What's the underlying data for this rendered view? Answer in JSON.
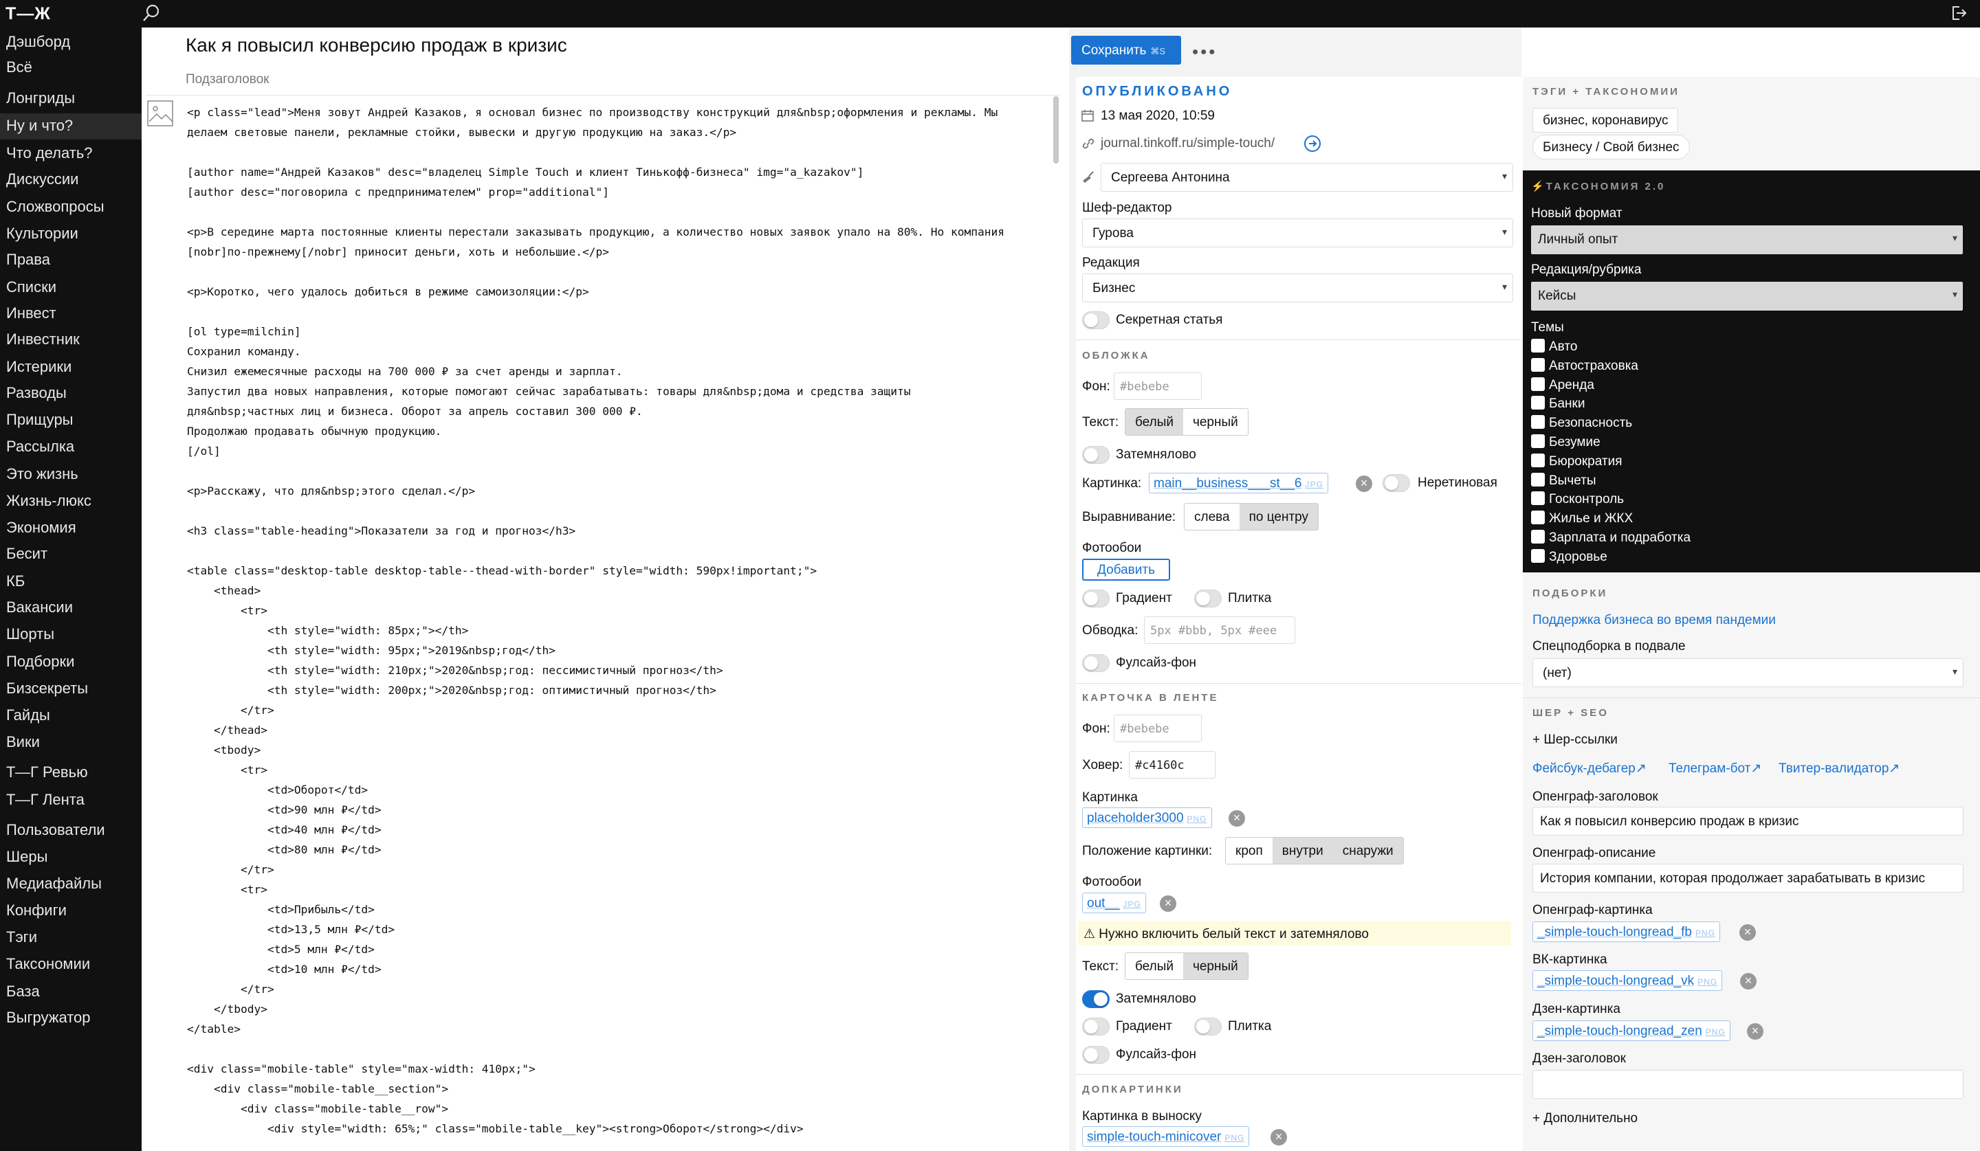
{
  "app": {
    "logo": "Т—Ж"
  },
  "sidebar": {
    "items": [
      "Дэшборд",
      "Всё",
      "Лонгриды",
      "Ну и что?",
      "Что делать?",
      "Дискуссии",
      "Сложвопросы",
      "Культории",
      "Права",
      "Списки",
      "Инвест",
      "Инвестник",
      "Истерики",
      "Разводы",
      "Прищуры",
      "Рассылка",
      "Это жизнь",
      "Жизнь-люкс",
      "Экономия",
      "Бесит",
      "КБ",
      "Вакансии",
      "Шорты",
      "Подборки",
      "Бизсекреты",
      "Гайды",
      "Вики",
      "Т—Г Ревью",
      "Т—Г Лента",
      "Пользователи",
      "Шеры",
      "Медиафайлы",
      "Конфиги",
      "Тэги",
      "Таксономии",
      "База",
      "Выгружатор"
    ],
    "active": "Лонгриды"
  },
  "editor": {
    "title": "Как я повысил конверсию продаж в кризис",
    "subtitle_placeholder": "Подзаголовок",
    "code_lines": [
      "<p class=\"lead\">Меня зовут Андрей Казаков, я основал бизнес по производству конструкций для&nbsp;оформления и рекламы. Мы",
      "делаем световые панели, рекламные стойки, вывески и другую продукцию на заказ.</p>",
      "",
      "[author name=\"Андрей Казаков\" desc=\"владелец Simple Touch и клиент Тинькофф-бизнеса\" img=\"a_kazakov\"]",
      "[author desc=\"поговорила с предпринимателем\" prop=\"additional\"]",
      "",
      "<p>В середине марта постоянные клиенты перестали заказывать продукцию, а количество новых заявок упало на 80%. Но компания",
      "[nobr]по-прежнему[/nobr] приносит деньги, хоть и небольшие.</p>",
      "",
      "<p>Коротко, чего удалось добиться в режиме самоизоляции:</p>",
      "",
      "[ol type=milchin]",
      "Сохранил команду.",
      "Снизил ежемесячные расходы на 700 000 ₽ за счет аренды и зарплат.",
      "Запустил два новых направления, которые помогают сейчас зарабатывать: товары для&nbsp;дома и средства защиты",
      "для&nbsp;частных лиц и бизнеса. Оборот за апрель составил 300 000 ₽.",
      "Продолжаю продавать обычную продукцию.",
      "[/ol]",
      "",
      "<p>Расскажу, что для&nbsp;этого сделал.</p>",
      "",
      "<h3 class=\"table-heading\">Показатели за год и прогноз</h3>",
      "",
      "<table class=\"desktop-table desktop-table--thead-with-border\" style=\"width: 590px!important;\">",
      "    <thead>",
      "        <tr>",
      "            <th style=\"width: 85px;\"></th>",
      "            <th style=\"width: 95px;\">2019&nbsp;год</th>",
      "            <th style=\"width: 210px;\">2020&nbsp;год: пессимистичный прогноз</th>",
      "            <th style=\"width: 200px;\">2020&nbsp;год: оптимистичный прогноз</th>",
      "        </tr>",
      "    </thead>",
      "    <tbody>",
      "        <tr>",
      "            <td>Оборот</td>",
      "            <td>90 млн ₽</td>",
      "            <td>40 млн ₽</td>",
      "            <td>80 млн ₽</td>",
      "        </tr>",
      "        <tr>",
      "            <td>Прибыль</td>",
      "            <td>13,5 млн ₽</td>",
      "            <td>5 млн ₽</td>",
      "            <td>10 млн ₽</td>",
      "        </tr>",
      "    </tbody>",
      "</table>",
      "",
      "<div class=\"mobile-table\" style=\"max-width: 410px;\">",
      "    <div class=\"mobile-table__section\">",
      "        <div class=\"mobile-table__row\">",
      "            <div style=\"width: 65%;\" class=\"mobile-table__key\"><strong>Оборот</strong></div>"
    ]
  },
  "toolbar": {
    "save_label": "Сохранить",
    "save_shortcut": "⌘S",
    "more": "•••"
  },
  "publish": {
    "status": "ОПУБЛИКОВАНО",
    "date": "13 мая 2020, 10:59",
    "url": "journal.tinkoff.ru/simple-touch/",
    "author": "Сергеева Антонина",
    "chief_label": "Шеф-редактор",
    "chief": "Гурова",
    "edition_label": "Редакция",
    "edition": "Бизнес",
    "secret_label": "Секретная статья"
  },
  "cover": {
    "heading": "ОБЛОЖКА",
    "bg_label": "Фон:",
    "bg_placeholder": "#bebebe",
    "text_label": "Текст:",
    "text_options": [
      "белый",
      "черный"
    ],
    "text_selected": "черный",
    "darken_label": "Затемнялово",
    "pic_label": "Картинка:",
    "pic_file": "main__business___st__6",
    "pic_ext": "JPG",
    "nonretina_label": "Неретиновая",
    "align_label": "Выравнивание:",
    "align_options": [
      "слева",
      "по центру"
    ],
    "align_selected": "слева",
    "wallpaper_label": "Фотообои",
    "add_label": "Добавить",
    "gradient_label": "Градиент",
    "tile_label": "Плитка",
    "stroke_label": "Обводка:",
    "stroke_placeholder": "5px #bbb, 5px #eee",
    "fullsize_label": "Фулсайз-фон"
  },
  "card": {
    "heading": "КАРТОЧКА В ЛЕНТЕ",
    "bg_label": "Фон:",
    "bg_placeholder": "#bebebe",
    "hover_label": "Ховер:",
    "hover_value": "#c4160c",
    "pic_label": "Картинка",
    "pic_file": "placeholder3000",
    "pic_ext": "PNG",
    "pos_label": "Положение картинки:",
    "pos_options": [
      "кроп",
      "внутри",
      "снаружи"
    ],
    "pos_selected": "кроп",
    "wallpaper_label": "Фотообои",
    "wallpaper_file": "out__",
    "wallpaper_ext": "JPG",
    "warning": "⚠ Нужно включить белый текст и затемнялово",
    "text_label": "Текст:",
    "text_options": [
      "белый",
      "черный"
    ],
    "text_selected": "белый",
    "darken_label": "Затемнялово",
    "darken_on": true,
    "gradient_label": "Градиент",
    "tile_label": "Плитка",
    "fullsize_label": "Фулсайз-фон"
  },
  "extra_pics": {
    "heading": "ДОПКАРТИНКИ",
    "callout_label": "Картинка в выноску",
    "callout_file": "simple-touch-minicover",
    "callout_ext": "PNG"
  },
  "tags": {
    "heading": "ТЭГИ + ТАКСОНОМИИ",
    "tags": "бизнес, коронавирус",
    "rubric": "Бизнесу / Свой бизнес"
  },
  "taxonomy2": {
    "heading": "⚡ТАКСОНОМИЯ 2.0",
    "format_label": "Новый формат",
    "format": "Личный опыт",
    "rubric_label": "Редакция/рубрика",
    "rubric": "Кейсы",
    "themes_label": "Темы",
    "themes": [
      "Авто",
      "Автостраховка",
      "Аренда",
      "Банки",
      "Безопасность",
      "Безумие",
      "Бюрократия",
      "Вычеты",
      "Госконтроль",
      "Жилье и ЖКХ",
      "Зарплата и подработка",
      "Здоровье"
    ]
  },
  "collections": {
    "heading": "ПОДБОРКИ",
    "link": "Поддержка бизнеса во время пандемии",
    "footer_label": "Спецподборка в подвале",
    "footer_value": "(нет)"
  },
  "share": {
    "heading": "ШЕР + SEO",
    "share_links": "+ Шер-ссылки",
    "debuggers": [
      "Фейсбук-дебагер↗",
      "Телеграм-бот↗",
      "Твитер-валидатор↗"
    ],
    "og_title_label": "Опенграф-заголовок",
    "og_title": "Как я повысил конверсию продаж в кризис",
    "og_desc_label": "Опенграф-описание",
    "og_desc": "История компании, которая продолжает зарабатывать в кризис",
    "og_pic_label": "Опенграф-картинка",
    "og_pic": "_simple-touch-longread_fb",
    "vk_label": "ВК-картинка",
    "vk_pic": "_simple-touch-longread_vk",
    "zen_label": "Дзен-картинка",
    "zen_pic": "_simple-touch-longread_zen",
    "zen_title_label": "Дзен-заголовок",
    "more": "+ Дополнительно",
    "ext": "PNG"
  }
}
